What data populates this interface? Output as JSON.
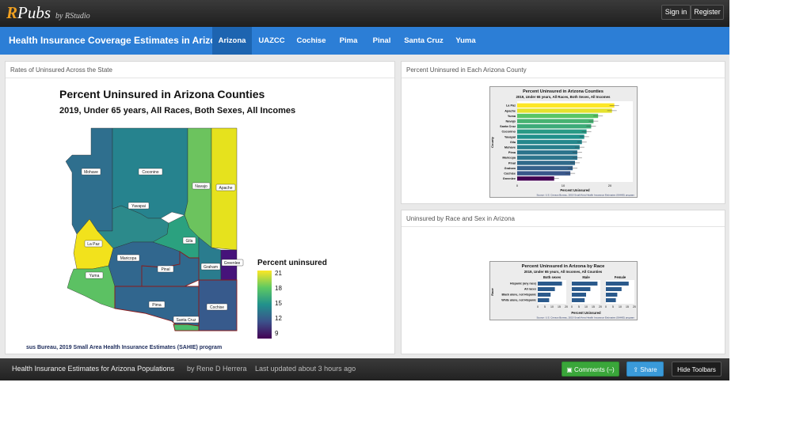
{
  "header": {
    "logo_r": "R",
    "logo_rest": "Pubs",
    "byline": "by RStudio",
    "sign_in": "Sign in",
    "register": "Register"
  },
  "nav": {
    "title": "Health Insurance Coverage Estimates in Arizona",
    "tabs": [
      "Arizona",
      "UAZCC",
      "Cochise",
      "Pima",
      "Pinal",
      "Santa Cruz",
      "Yuma"
    ],
    "active": "Arizona"
  },
  "panels": {
    "map": {
      "title": "Rates of Uninsured Across the State",
      "plot_title": "Percent Uninsured in Arizona Counties",
      "plot_subtitle": "2019, Under 65 years, All Races, Both Sexes, All Incomes",
      "caption": "sus Bureau, 2019 Small Area Health Insurance Estimates (SAHIE) program",
      "legend_title": "Percent uninsured",
      "legend_ticks": [
        "21",
        "18",
        "15",
        "12",
        "9"
      ],
      "county_labels": [
        "Mohave",
        "Coconino",
        "Navajo",
        "Apache",
        "Yavapai",
        "La Paz",
        "Gila",
        "Maricopa",
        "Pinal",
        "Graham",
        "Greenlee",
        "Yuma",
        "Pima",
        "Cochise",
        "Santa Cruz"
      ]
    },
    "bar": {
      "title": "Percent Uninsured in Each Arizona County",
      "plot_title": "Percent Uninsured in Arizona Counties",
      "plot_subtitle": "2019, Under 65 years, All Races, Both Sexes, All Incomes",
      "ylabel": "County",
      "xlabel": "Percent Uninsured",
      "x_ticks": [
        "0",
        "10",
        "20"
      ],
      "source": "Source: U.S. Census Bureau, 2019 Small Area Health Insurance Estimates (SAHIE) program"
    },
    "race": {
      "title": "Uninsured by Race and Sex in Arizona",
      "plot_title": "Percent Uninsured in Arizona by Race",
      "plot_subtitle": "2019, Under 65 years, All Incomes, All Counties",
      "facets": [
        "Both sexes",
        "Male",
        "Female"
      ],
      "ylabel": "Race",
      "xlabel": "Percent Uninsured",
      "x_ticks": [
        "0",
        "5",
        "10",
        "15",
        "20"
      ],
      "source": "Source: U.S. Census Bureau, 2019 Small Area Health Insurance Estimates (SAHIE) program"
    }
  },
  "chart_data": [
    {
      "type": "bar",
      "title": "Percent Uninsured in Arizona Counties",
      "xlabel": "Percent Uninsured",
      "ylabel": "County",
      "categories": [
        "La Paz",
        "Apache",
        "Yuma",
        "Navajo",
        "Santa Cruz",
        "Coconino",
        "Yavapai",
        "Gila",
        "Mohave",
        "Pima",
        "Maricopa",
        "Pinal",
        "Graham",
        "Cochise",
        "Greenlee"
      ],
      "values": [
        21,
        20.5,
        17.5,
        16.5,
        16,
        15,
        14.5,
        14,
        13.5,
        13,
        13,
        12.5,
        12,
        11.5,
        8
      ],
      "xlim": [
        0,
        25
      ]
    },
    {
      "type": "bar",
      "title": "Percent Uninsured in Arizona by Race",
      "categories": [
        "Hispanic (any race)",
        "All races",
        "Black alone, not Hispanic",
        "White alone, not Hispanic"
      ],
      "series": [
        {
          "name": "Both sexes",
          "values": [
            17,
            12,
            9,
            8
          ]
        },
        {
          "name": "Male",
          "values": [
            18,
            13,
            10,
            9
          ]
        },
        {
          "name": "Female",
          "values": [
            16,
            11,
            8,
            7
          ]
        }
      ],
      "xlim": [
        0,
        20
      ]
    }
  ],
  "footer": {
    "title": "Health Insurance Estimates for Arizona Populations",
    "author": "by Rene D Herrera",
    "updated": "Last updated about 3 hours ago",
    "comments": "Comments (–)",
    "share": "Share",
    "hide": "Hide Toolbars"
  },
  "colors": {
    "nav_blue": "#2c7ed6",
    "nav_active": "#1d64b0",
    "comments_green": "#3aa63a",
    "share_blue": "#3a9ad9"
  }
}
